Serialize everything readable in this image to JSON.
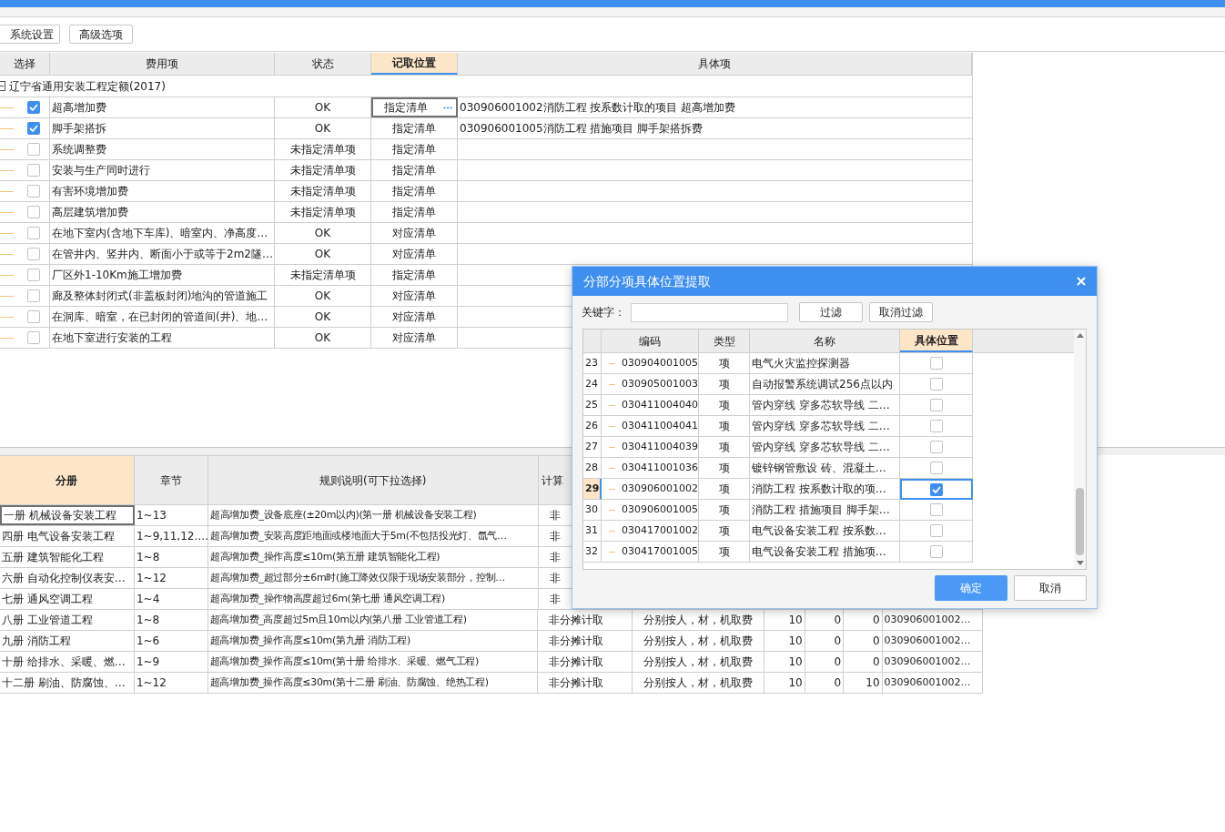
{
  "toolbar": {
    "buttons": [
      "系统设置",
      "高级选项"
    ]
  },
  "fee_table": {
    "columns": [
      {
        "label": "选择",
        "selected": false
      },
      {
        "label": "费用项",
        "selected": false
      },
      {
        "label": "状态",
        "selected": false
      },
      {
        "label": "记取位置",
        "selected": true
      },
      {
        "label": "具体项",
        "selected": false
      }
    ],
    "group": {
      "label": "辽宁省通用安装工程定额(2017)",
      "expanded": true
    },
    "rows": [
      {
        "name": "超高增加费",
        "checked": true,
        "status": "OK",
        "position": "指定清单",
        "detail": "030906001002消防工程  按系数计取的项目  超高增加费",
        "editing": true
      },
      {
        "name": "脚手架搭拆",
        "checked": true,
        "status": "OK",
        "position": "指定清单",
        "detail": "030906001005消防工程  措施项目  脚手架搭拆费",
        "editing": false
      },
      {
        "name": "系统调整费",
        "checked": false,
        "status": "未指定清单项",
        "position": "指定清单",
        "editing": false
      },
      {
        "name": "安装与生产同时进行",
        "checked": false,
        "status": "未指定清单项",
        "position": "指定清单",
        "editing": false
      },
      {
        "name": "有害环境增加费",
        "checked": false,
        "status": "未指定清单项",
        "position": "指定清单",
        "editing": false
      },
      {
        "name": "高层建筑增加费",
        "checked": false,
        "status": "未指定清单项",
        "position": "指定清单",
        "editing": false
      },
      {
        "name": "在地下室内(含地下车库)、暗室内、净高度…",
        "checked": false,
        "status": "OK",
        "position": "对应清单",
        "editing": false
      },
      {
        "name": "在管井内、竖井内、断面小于或等于2m2隧…",
        "checked": false,
        "status": "OK",
        "position": "对应清单",
        "editing": false
      },
      {
        "name": "厂区外1-10Km施工增加费",
        "checked": false,
        "status": "未指定清单项",
        "position": "指定清单",
        "editing": false
      },
      {
        "name": "廊及整体封闭式(非盖板封闭)地沟的管道施工",
        "checked": false,
        "status": "OK",
        "position": "对应清单",
        "editing": false
      },
      {
        "name": "在洞库、暗室，在已封闭的管道间(井)、地…",
        "checked": false,
        "status": "OK",
        "position": "对应清单",
        "editing": false
      },
      {
        "name": "在地下室进行安装的工程",
        "checked": false,
        "status": "OK",
        "position": "对应清单",
        "editing": false
      }
    ]
  },
  "rule_table": {
    "columns": [
      {
        "label": "分册",
        "selected": true
      },
      {
        "label": "章节",
        "selected": false
      },
      {
        "label": "规则说明(可下拉选择)",
        "selected": false
      },
      {
        "label": "计算",
        "selected": false
      }
    ],
    "rows": [
      {
        "selected": true,
        "cells": [
          "一册 机械设备安装工程",
          "1~13",
          "超高增加费_设备底座(±20m以内)(第一册 机械设备安装工程)",
          "非"
        ]
      },
      {
        "selected": false,
        "cells": [
          "四册 电气设备安装工程",
          "1~9,11,12.…",
          "超高增加费_安装高度距地面或楼地面大于5m(不包括投光灯、氙气…",
          "非"
        ]
      },
      {
        "selected": false,
        "cells": [
          "五册 建筑智能化工程",
          "1~8",
          "超高增加费_操作高度≤10m(第五册 建筑智能化工程)",
          "非"
        ]
      },
      {
        "selected": false,
        "cells": [
          "六册 自动化控制仪表安…",
          "1~12",
          "超高增加费_超过部分±6m时(施工降效仅限于现场安装部分，控制…",
          "非"
        ]
      },
      {
        "selected": false,
        "cells": [
          "七册 通风空调工程",
          "1~4",
          "超高增加费_操作物高度超过6m(第七册 通风空调工程)",
          "非"
        ]
      },
      {
        "selected": false,
        "cells": [
          "八册 工业管道工程",
          "1~8",
          "超高增加费_高度超过5m且10m以内(第八册 工业管道工程)",
          "非分摊计取",
          "分别按人，材，机取费",
          "10",
          "0",
          "0",
          "030906001002…"
        ]
      },
      {
        "selected": false,
        "cells": [
          "九册 消防工程",
          "1~6",
          "超高增加费_操作高度≤10m(第九册 消防工程)",
          "非分摊计取",
          "分别按人，材，机取费",
          "10",
          "0",
          "0",
          "030906001002…"
        ]
      },
      {
        "selected": false,
        "cells": [
          "十册 给排水、采暖、燃…",
          "1~9",
          "超高增加费_操作高度≤10m(第十册 给排水、采暖、燃气工程)",
          "非分摊计取",
          "分别按人，材，机取费",
          "10",
          "0",
          "0",
          "030906001002…"
        ]
      },
      {
        "selected": false,
        "cells": [
          "十二册 刷油、防腐蚀、…",
          "1~12",
          "超高增加费_操作高度≤30m(第十二册 刷油、防腐蚀、绝热工程)",
          "非分摊计取",
          "分别按人，材，机取费",
          "10",
          "0",
          "10",
          "030906001002…"
        ]
      }
    ]
  },
  "dialog": {
    "title": "分部分项具体位置提取",
    "keyword_label": "关键字：",
    "filter_button": "过滤",
    "clear_filter_button": "取消过滤",
    "columns": [
      {
        "label": "编码",
        "selected": false
      },
      {
        "label": "类型",
        "selected": false
      },
      {
        "label": "名称",
        "selected": false
      },
      {
        "label": "具体位置",
        "selected": true
      }
    ],
    "rows": [
      {
        "num": "23",
        "code": "030904001005",
        "type": "项",
        "name": "电气火灾监控探测器",
        "checked": false,
        "selected": false
      },
      {
        "num": "24",
        "code": "030905001003",
        "type": "项",
        "name": "自动报警系统调试256点以内",
        "checked": false,
        "selected": false
      },
      {
        "num": "25",
        "code": "030411004040",
        "type": "项",
        "name": "管内穿线  穿多芯软导线  二…",
        "checked": false,
        "selected": false
      },
      {
        "num": "26",
        "code": "030411004041",
        "type": "项",
        "name": "管内穿线  穿多芯软导线  二…",
        "checked": false,
        "selected": false
      },
      {
        "num": "27",
        "code": "030411004039",
        "type": "项",
        "name": "管内穿线  穿多芯软导线  二…",
        "checked": false,
        "selected": false
      },
      {
        "num": "28",
        "code": "030411001036",
        "type": "项",
        "name": "镀锌钢管敷设  砖、混凝土…",
        "checked": false,
        "selected": false
      },
      {
        "num": "29",
        "code": "030906001002",
        "type": "项",
        "name": "消防工程  按系数计取的项…",
        "checked": true,
        "selected": true
      },
      {
        "num": "30",
        "code": "030906001005",
        "type": "项",
        "name": "消防工程  措施项目  脚手架…",
        "checked": false,
        "selected": false
      },
      {
        "num": "31",
        "code": "030417001002",
        "type": "项",
        "name": "电气设备安装工程  按系数…",
        "checked": false,
        "selected": false
      },
      {
        "num": "32",
        "code": "030417001005",
        "type": "项",
        "name": "电气设备安装工程  措施项…",
        "checked": false,
        "selected": false
      }
    ],
    "ok_button": "确定",
    "cancel_button": "取消"
  }
}
